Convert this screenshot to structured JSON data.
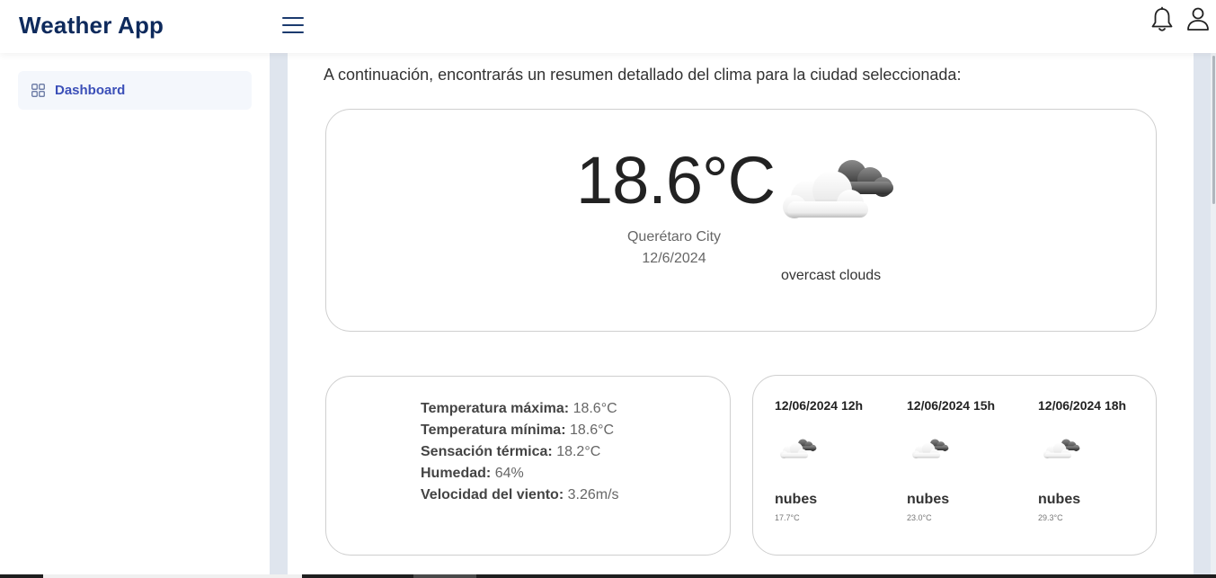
{
  "header": {
    "app_title": "Weather App",
    "menu_icon": "hamburger-menu-icon",
    "notification_icon": "bell-icon",
    "profile_icon": "user-icon"
  },
  "sidebar": {
    "items": [
      {
        "label": "Dashboard",
        "icon": "grid-icon",
        "active": true
      }
    ]
  },
  "main": {
    "intro": "A continuación, encontrarás un resumen detallado del clima para la ciudad seleccionada:",
    "current": {
      "temperature": "18.6°C",
      "city": "Querétaro City",
      "date": "12/6/2024",
      "description": "overcast clouds",
      "icon": "overcast-clouds-icon"
    },
    "details": {
      "rows": [
        {
          "label": "Temperatura máxima:",
          "value": "18.6°C"
        },
        {
          "label": "Temperatura mínima:",
          "value": "18.6°C"
        },
        {
          "label": "Sensación térmica:",
          "value": "18.2°C"
        },
        {
          "label": "Humedad:",
          "value": "64%"
        },
        {
          "label": "Velocidad del viento:",
          "value": "3.26m/s"
        }
      ]
    },
    "forecast": [
      {
        "time": "12/06/2024 12h",
        "description": "nubes",
        "temperature": "17.7°C",
        "icon": "overcast-clouds-icon"
      },
      {
        "time": "12/06/2024 15h",
        "description": "nubes",
        "temperature": "23.0°C",
        "icon": "overcast-clouds-icon"
      },
      {
        "time": "12/06/2024 18h",
        "description": "nubes",
        "temperature": "29.3°C",
        "icon": "overcast-clouds-icon"
      }
    ]
  },
  "colors": {
    "brand": "#0e2a5c",
    "nav_active_text": "#3b4fb8",
    "nav_active_bg": "#f4f7fc",
    "page_bg": "#dfe5ee"
  }
}
